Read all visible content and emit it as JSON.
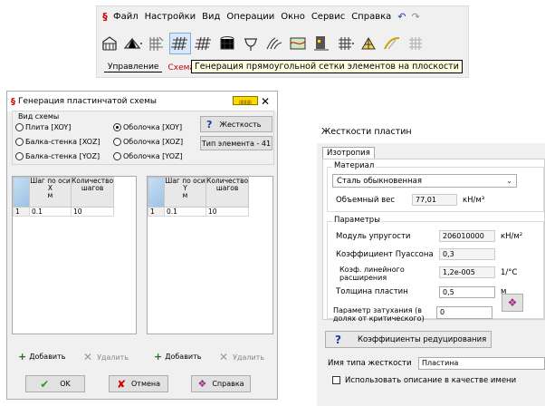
{
  "menubar": {
    "items": [
      "Файл",
      "Настройки",
      "Вид",
      "Операции",
      "Окно",
      "Сервис",
      "Справка"
    ]
  },
  "toolbar": {
    "icons": [
      "frame-building-icon",
      "roof-truss-icon",
      "grid-icon",
      "mesh-grid-icon",
      "mesh-icon",
      "grid-cube-icon",
      "arch-icon",
      "terrain-icon",
      "wall-icon",
      "node-grid-icon",
      "triangulation-icon",
      "surface-icon",
      "grid-lines-icon",
      "wireframe-icon"
    ]
  },
  "tabs": [
    "Управление",
    "Схема"
  ],
  "tooltip": "Генерация прямоугольной сетки элементов на плоскости",
  "dialog": {
    "title": "Генерация пластинчатой схемы",
    "scheme_group": "Вид схемы",
    "radios": [
      {
        "label": "Плита [XOY]",
        "checked": false
      },
      {
        "label": "Балка-стенка [XOZ]",
        "checked": false
      },
      {
        "label": "Балка-стенка [YOZ]",
        "checked": false
      },
      {
        "label": "Оболочка [XOY]",
        "checked": true
      },
      {
        "label": "Оболочка [XOZ]",
        "checked": false
      },
      {
        "label": "Оболочка [YOZ]",
        "checked": false
      }
    ],
    "stiffness_button": "Жесткость",
    "element_type_button": "Тип элемента - 41",
    "grid_x": {
      "col1_lines": [
        "Шаг по оси",
        "X",
        "м"
      ],
      "col2_lines": [
        "Количество",
        "шагов"
      ],
      "rows": [
        {
          "n": "1",
          "step": "0.1",
          "count": "10"
        }
      ]
    },
    "grid_y": {
      "col1_lines": [
        "Шаг по оси",
        "Y",
        "м"
      ],
      "col2_lines": [
        "Количество",
        "шагов"
      ],
      "rows": [
        {
          "n": "1",
          "step": "0.1",
          "count": "10"
        }
      ]
    },
    "add_label": "Добавить",
    "delete_label": "Удалить",
    "ok_label": "OK",
    "cancel_label": "Отмена",
    "help_label": "Справка"
  },
  "stiffness_panel": {
    "title": "Жесткости пластин",
    "tab": "Изотропия",
    "material_group": "Материал",
    "material_value": "Сталь обыкновенная",
    "volume_weight_label": "Объемный вес",
    "volume_weight_value": "77,01",
    "volume_weight_unit": "кН/м³",
    "params_group": "Параметры",
    "modulus_label": "Модуль упругости",
    "modulus_value": "206010000",
    "modulus_unit": "кН/м²",
    "poisson_label": "Коэффициент Пуассона",
    "poisson_value": "0,3",
    "expansion_label_1": "Коэф. линейного",
    "expansion_label_2": "расширения",
    "expansion_value": "1,2е-005",
    "expansion_unit": "1/°С",
    "thickness_label": "Толщина пластин",
    "thickness_value": "0,5",
    "thickness_unit": "м",
    "damping_label_1": "Параметр затухания (в",
    "damping_label_2": "долях от критического)",
    "damping_value": "0",
    "reduction_button": "Коэффициенты редуцирования",
    "stiffness_type_label": "Имя типа жесткости",
    "stiffness_type_value": "Пластина",
    "use_description_label": "Использовать описание в качестве имени"
  }
}
